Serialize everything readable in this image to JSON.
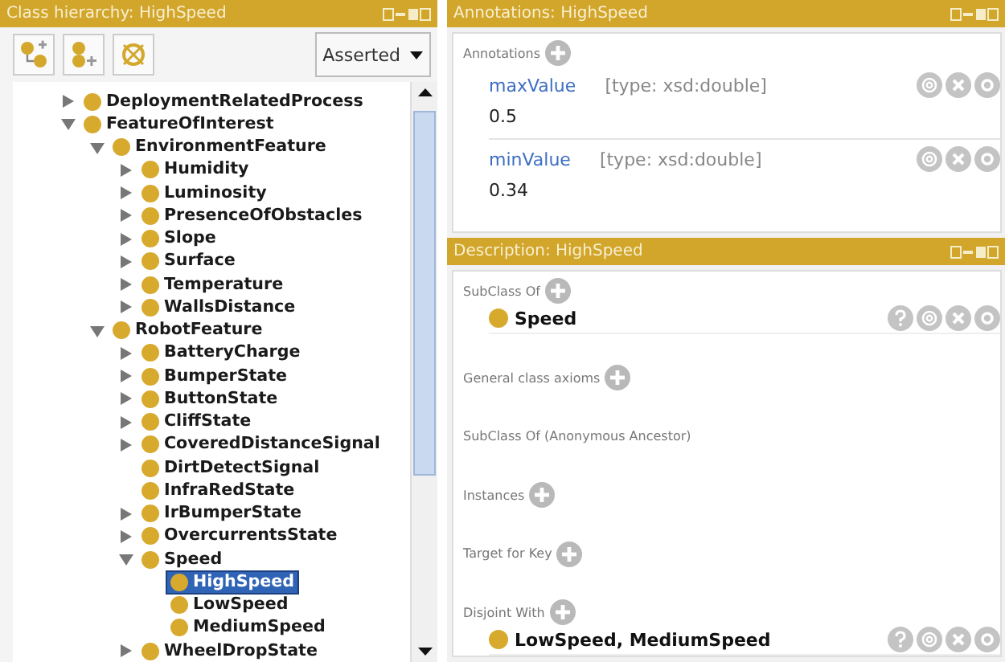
{
  "hierarchy": {
    "title": "Class hierarchy: HighSpeed",
    "mode": "Asserted",
    "tree": [
      {
        "label": "DeploymentRelatedProcess",
        "kind": "branch",
        "expanded": false,
        "selected": false
      },
      {
        "label": "FeatureOfInterest",
        "kind": "branch",
        "expanded": true,
        "selected": false,
        "children": [
          {
            "label": "EnvironmentFeature",
            "kind": "branch",
            "expanded": true,
            "selected": false,
            "children": [
              {
                "label": "Humidity",
                "kind": "branch",
                "expanded": false,
                "selected": false
              },
              {
                "label": "Luminosity",
                "kind": "branch",
                "expanded": false,
                "selected": false
              },
              {
                "label": "PresenceOfObstacles",
                "kind": "branch",
                "expanded": false,
                "selected": false
              },
              {
                "label": "Slope",
                "kind": "branch",
                "expanded": false,
                "selected": false
              },
              {
                "label": "Surface",
                "kind": "branch",
                "expanded": false,
                "selected": false
              },
              {
                "label": "Temperature",
                "kind": "branch",
                "expanded": false,
                "selected": false
              },
              {
                "label": "WallsDistance",
                "kind": "branch",
                "expanded": false,
                "selected": false
              }
            ]
          },
          {
            "label": "RobotFeature",
            "kind": "branch",
            "expanded": true,
            "selected": false,
            "children": [
              {
                "label": "BatteryCharge",
                "kind": "branch",
                "expanded": false,
                "selected": false
              },
              {
                "label": "BumperState",
                "kind": "branch",
                "expanded": false,
                "selected": false
              },
              {
                "label": "ButtonState",
                "kind": "branch",
                "expanded": false,
                "selected": false
              },
              {
                "label": "CliffState",
                "kind": "branch",
                "expanded": false,
                "selected": false
              },
              {
                "label": "CoveredDistanceSignal",
                "kind": "branch",
                "expanded": false,
                "selected": false
              },
              {
                "label": "DirtDetectSignal",
                "kind": "leaf",
                "selected": false
              },
              {
                "label": "InfraRedState",
                "kind": "leaf",
                "selected": false
              },
              {
                "label": "IrBumperState",
                "kind": "branch",
                "expanded": false,
                "selected": false
              },
              {
                "label": "OvercurrentsState",
                "kind": "branch",
                "expanded": false,
                "selected": false
              },
              {
                "label": "Speed",
                "kind": "branch",
                "expanded": true,
                "selected": false,
                "children": [
                  {
                    "label": "HighSpeed",
                    "kind": "leaf",
                    "selected": true
                  },
                  {
                    "label": "LowSpeed",
                    "kind": "leaf",
                    "selected": false
                  },
                  {
                    "label": "MediumSpeed",
                    "kind": "leaf",
                    "selected": false
                  }
                ]
              },
              {
                "label": "WheelDropState",
                "kind": "branch",
                "expanded": false,
                "selected": false
              }
            ]
          }
        ]
      }
    ]
  },
  "annotations": {
    "title": "Annotations: HighSpeed",
    "label": "Annotations",
    "items": [
      {
        "property": "maxValue",
        "type": "[type: xsd:double]",
        "value": "0.5"
      },
      {
        "property": "minValue",
        "type": "[type: xsd:double]",
        "value": "0.34"
      }
    ]
  },
  "description": {
    "title": "Description: HighSpeed",
    "sections": [
      {
        "label": "SubClass Of",
        "has_add": true,
        "items": [
          "Speed"
        ]
      },
      {
        "label": "General class axioms",
        "has_add": true
      },
      {
        "label": "SubClass Of (Anonymous Ancestor)",
        "has_add": false
      },
      {
        "label": "Instances",
        "has_add": true
      },
      {
        "label": "Target for Key",
        "has_add": true
      },
      {
        "label": "Disjoint With",
        "has_add": true,
        "items": [
          "LowSpeed, MediumSpeed"
        ]
      }
    ]
  }
}
